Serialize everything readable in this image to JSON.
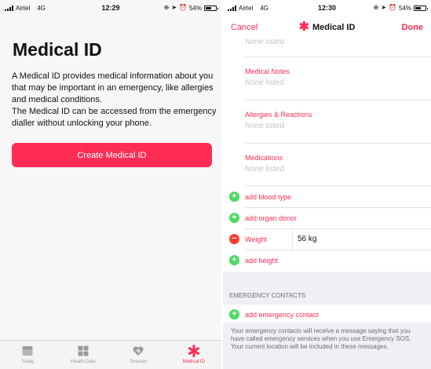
{
  "left": {
    "status": {
      "carrier": "Airtel",
      "network": "4G",
      "time": "12:29",
      "battery": "54%"
    },
    "title": "Medical ID",
    "intro_line1": "A Medical ID provides medical information about you that may be important in an emergency, like allergies and medical conditions.",
    "intro_line2": "The Medical ID can be accessed from the emergency dialler without unlocking your phone.",
    "create_button": "Create Medical ID",
    "tabs": [
      {
        "label": "Today",
        "icon": "today-icon"
      },
      {
        "label": "Health Data",
        "icon": "grid-icon"
      },
      {
        "label": "Sources",
        "icon": "heart-icon"
      },
      {
        "label": "Medical ID",
        "icon": "asterisk-icon",
        "active": true
      }
    ]
  },
  "right": {
    "status": {
      "carrier": "Airtel",
      "network": "4G",
      "time": "12:30",
      "battery": "54%"
    },
    "nav": {
      "cancel": "Cancel",
      "title": "Medical ID",
      "done": "Done"
    },
    "top_value": "None listed",
    "fields": [
      {
        "label": "Medical Notes",
        "value": "None listed"
      },
      {
        "label": "Allergies & Reactions",
        "value": "None listed"
      },
      {
        "label": "Medications",
        "value": "None listed"
      }
    ],
    "add_blood_type": "add blood type",
    "add_organ_donor": "add organ donor",
    "weight_label": "Weight",
    "weight_value": "56 kg",
    "add_height": "add height",
    "emergency_header": "EMERGENCY CONTACTS",
    "add_emergency_contact": "add emergency contact",
    "footer_note": "Your emergency contacts will receive a message saying that you have called emergency services when you use Emergency SOS. Your current location will be included in these messages."
  },
  "colors": {
    "accent": "#ff2d55",
    "add_green": "#4cd964",
    "remove_red": "#ff3b30",
    "grouped_bg": "#efeff4"
  }
}
